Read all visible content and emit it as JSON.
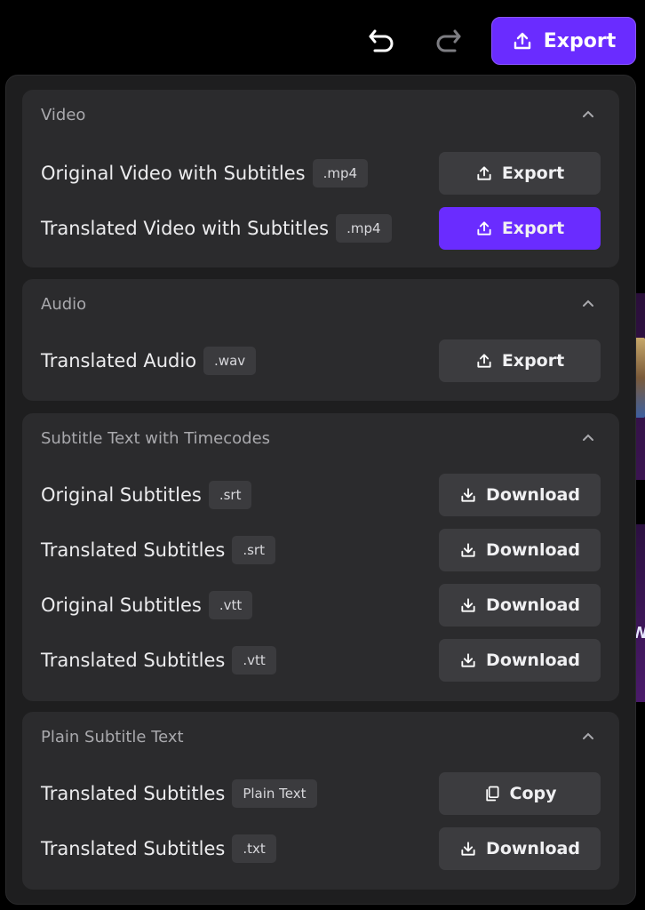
{
  "toolbar": {
    "undo_icon": "undo-icon",
    "redo_icon": "redo-icon",
    "export_label": "Export",
    "export_icon": "upload-icon"
  },
  "colors": {
    "accent": "#6a2cff",
    "panel": "#1e1e1f",
    "section": "#2b2b2d",
    "button": "#3c3c3f"
  },
  "sections": [
    {
      "title": "Video",
      "rows": [
        {
          "label": "Original Video with Subtitles",
          "format": ".mp4",
          "action": "Export",
          "icon": "upload-icon",
          "primary": false
        },
        {
          "label": "Translated Video with Subtitles",
          "format": ".mp4",
          "action": "Export",
          "icon": "upload-icon",
          "primary": true
        }
      ]
    },
    {
      "title": "Audio",
      "rows": [
        {
          "label": "Translated Audio",
          "format": ".wav",
          "action": "Export",
          "icon": "upload-icon",
          "primary": false
        }
      ]
    },
    {
      "title": "Subtitle Text with Timecodes",
      "rows": [
        {
          "label": "Original Subtitles",
          "format": ".srt",
          "action": "Download",
          "icon": "download-icon",
          "primary": false
        },
        {
          "label": "Translated Subtitles",
          "format": ".srt",
          "action": "Download",
          "icon": "download-icon",
          "primary": false
        },
        {
          "label": "Original Subtitles",
          "format": ".vtt",
          "action": "Download",
          "icon": "download-icon",
          "primary": false
        },
        {
          "label": "Translated Subtitles",
          "format": ".vtt",
          "action": "Download",
          "icon": "download-icon",
          "primary": false
        }
      ]
    },
    {
      "title": "Plain Subtitle Text",
      "rows": [
        {
          "label": "Translated Subtitles",
          "format": "Plain Text",
          "action": "Copy",
          "icon": "copy-icon",
          "primary": false
        },
        {
          "label": "Translated Subtitles",
          "format": ".txt",
          "action": "Download",
          "icon": "download-icon",
          "primary": false
        }
      ]
    }
  ]
}
